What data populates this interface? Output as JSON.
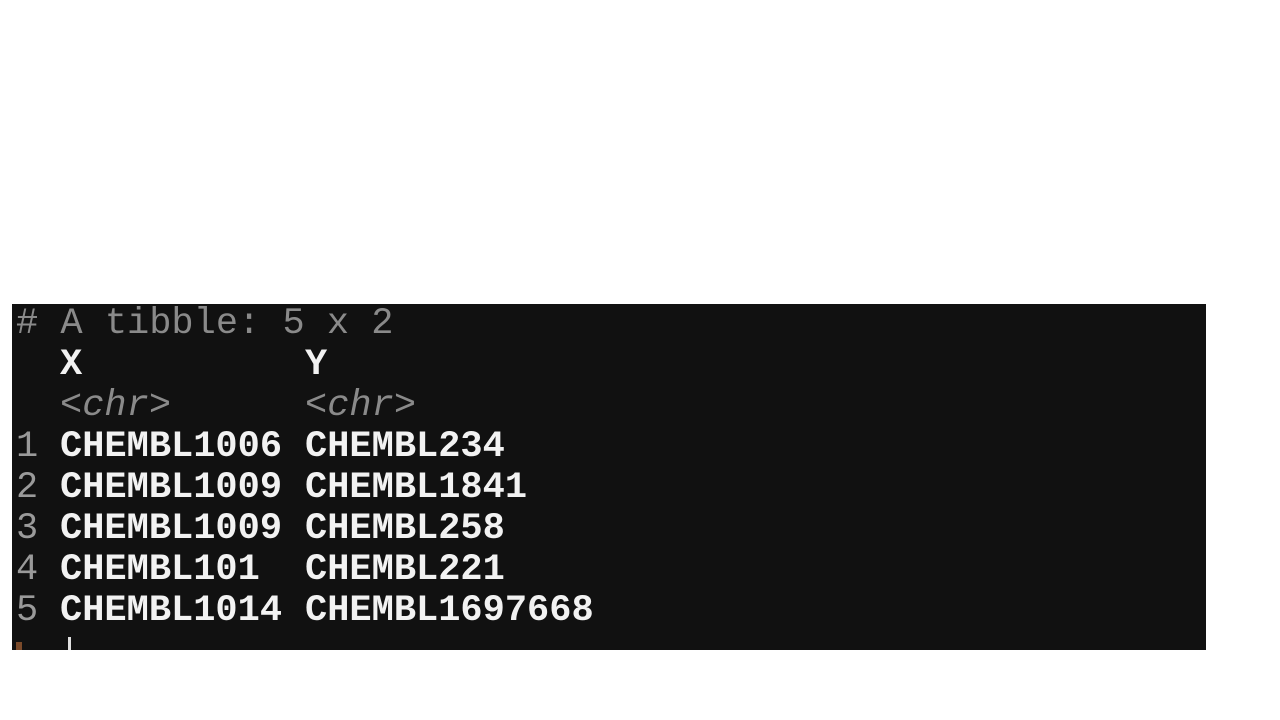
{
  "console": {
    "header": "# A tibble: 5 x 2",
    "columns": [
      {
        "name": "X",
        "type": "<chr>"
      },
      {
        "name": "Y",
        "type": "<chr>"
      }
    ],
    "rows": [
      {
        "index": "1",
        "X": "CHEMBL1006",
        "Y": "CHEMBL234"
      },
      {
        "index": "2",
        "X": "CHEMBL1009",
        "Y": "CHEMBL1841"
      },
      {
        "index": "3",
        "X": "CHEMBL1009",
        "Y": "CHEMBL258"
      },
      {
        "index": "4",
        "X": "CHEMBL101",
        "Y": "CHEMBL221"
      },
      {
        "index": "5",
        "X": "CHEMBL1014",
        "Y": "CHEMBL1697668"
      }
    ]
  }
}
